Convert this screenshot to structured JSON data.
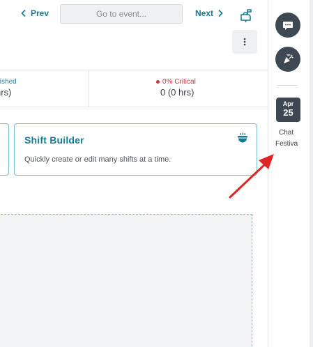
{
  "nav": {
    "prev_label": "Prev",
    "next_label": "Next",
    "goto_placeholder": "Go to event..."
  },
  "stats": {
    "published_label": "blished",
    "published_value": "hrs)",
    "critical_label": "0% Critical",
    "critical_value": "0 (0 hrs)"
  },
  "card": {
    "title": "Shift Builder",
    "description": "Quickly create or edit many shifts at a time."
  },
  "rail": {
    "date": {
      "month": "Apr",
      "day": "25",
      "caption_line1": "Chat",
      "caption_line2": "Festiva"
    }
  },
  "colors": {
    "accent": "#157a96",
    "critical": "#d0333b",
    "rail_button": "#3d4852",
    "annotation_arrow": "#e02424"
  },
  "icons": {
    "prev": "chevron-left-icon",
    "next": "chevron-right-icon",
    "mailbox": "mailbox-icon",
    "more": "more-vertical-icon",
    "card": "hot-dish-icon",
    "chat": "chat-bubble-icon",
    "celebrate": "party-popper-icon"
  }
}
